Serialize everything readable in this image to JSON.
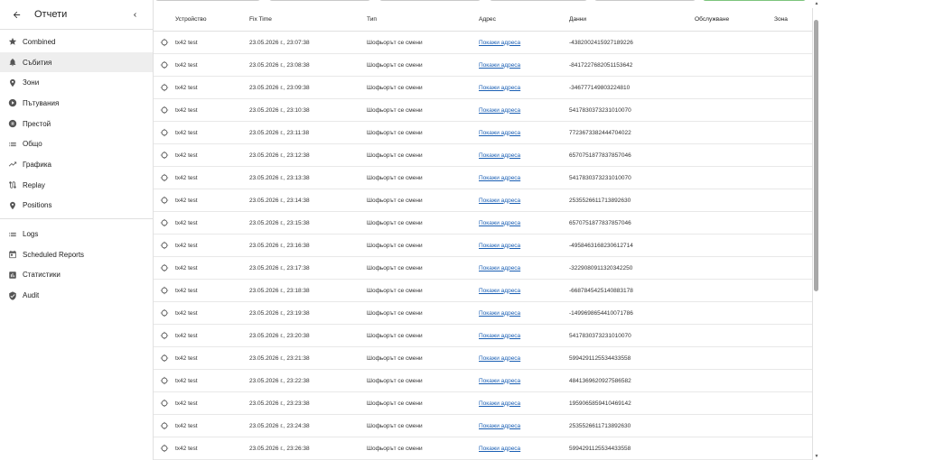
{
  "sidebar": {
    "title": "Отчети",
    "items_primary": [
      {
        "label": "Combined",
        "icon": "star-icon"
      },
      {
        "label": "Събития",
        "icon": "bell-icon",
        "active": true
      },
      {
        "label": "Зони",
        "icon": "place-icon"
      },
      {
        "label": "Пътувания",
        "icon": "play-circle-icon"
      },
      {
        "label": "Престой",
        "icon": "pause-circle-icon"
      },
      {
        "label": "Общо",
        "icon": "list-icon"
      },
      {
        "label": "Графика",
        "icon": "trending-up-icon"
      },
      {
        "label": "Replay",
        "icon": "route-icon"
      },
      {
        "label": "Positions",
        "icon": "place-icon"
      }
    ],
    "items_secondary": [
      {
        "label": "Logs",
        "icon": "list-icon"
      },
      {
        "label": "Scheduled Reports",
        "icon": "calendar-icon"
      },
      {
        "label": "Статистики",
        "icon": "chart-icon"
      },
      {
        "label": "Audit",
        "icon": "verified-icon"
      }
    ]
  },
  "table": {
    "headers": [
      "Устройство",
      "Fix Time",
      "Тип",
      "Адрес",
      "Данни",
      "Обслужване",
      "Зона"
    ],
    "rows": [
      {
        "device": "tx42 test",
        "time": "23.05.2026 г., 23:07:38",
        "type": "Шофьорът се смени",
        "address": "Покажи адреса",
        "data": "-4382002415927189226"
      },
      {
        "device": "tx42 test",
        "time": "23.05.2026 г., 23:08:38",
        "type": "Шофьорът се смени",
        "address": "Покажи адреса",
        "data": "-8417227682051153642"
      },
      {
        "device": "tx42 test",
        "time": "23.05.2026 г., 23:09:38",
        "type": "Шофьорът се смени",
        "address": "Покажи адреса",
        "data": "-346777149803224810"
      },
      {
        "device": "tx42 test",
        "time": "23.05.2026 г., 23:10:38",
        "type": "Шофьорът се смени",
        "address": "Покажи адреса",
        "data": "5417830373231010070"
      },
      {
        "device": "tx42 test",
        "time": "23.05.2026 г., 23:11:38",
        "type": "Шофьорът се смени",
        "address": "Покажи адреса",
        "data": "7723673382444704022"
      },
      {
        "device": "tx42 test",
        "time": "23.05.2026 г., 23:12:38",
        "type": "Шофьорът се смени",
        "address": "Покажи адреса",
        "data": "6570751877837857046"
      },
      {
        "device": "tx42 test",
        "time": "23.05.2026 г., 23:13:38",
        "type": "Шофьорът се смени",
        "address": "Покажи адреса",
        "data": "5417830373231010070"
      },
      {
        "device": "tx42 test",
        "time": "23.05.2026 г., 23:14:38",
        "type": "Шофьорът се смени",
        "address": "Покажи адреса",
        "data": "2535526611713892630"
      },
      {
        "device": "tx42 test",
        "time": "23.05.2026 г., 23:15:38",
        "type": "Шофьорът се смени",
        "address": "Покажи адреса",
        "data": "6570751877837857046"
      },
      {
        "device": "tx42 test",
        "time": "23.05.2026 г., 23:16:38",
        "type": "Шофьорът се смени",
        "address": "Покажи адреса",
        "data": "-4958463168230612714"
      },
      {
        "device": "tx42 test",
        "time": "23.05.2026 г., 23:17:38",
        "type": "Шофьорът се смени",
        "address": "Покажи адреса",
        "data": "-3229080911320342250"
      },
      {
        "device": "tx42 test",
        "time": "23.05.2026 г., 23:18:38",
        "type": "Шофьорът се смени",
        "address": "Покажи адреса",
        "data": "-6687845425140883178"
      },
      {
        "device": "tx42 test",
        "time": "23.05.2026 г., 23:19:38",
        "type": "Шофьорът се смени",
        "address": "Покажи адреса",
        "data": "-1499698654410071786"
      },
      {
        "device": "tx42 test",
        "time": "23.05.2026 г., 23:20:38",
        "type": "Шофьорът се смени",
        "address": "Покажи адреса",
        "data": "5417830373231010070"
      },
      {
        "device": "tx42 test",
        "time": "23.05.2026 г., 23:21:38",
        "type": "Шофьорът се смени",
        "address": "Покажи адреса",
        "data": "5994291125534433558"
      },
      {
        "device": "tx42 test",
        "time": "23.05.2026 г., 23:22:38",
        "type": "Шофьорът се смени",
        "address": "Покажи адреса",
        "data": "4841369620927586582"
      },
      {
        "device": "tx42 test",
        "time": "23.05.2026 г., 23:23:38",
        "type": "Шофьорът се смени",
        "address": "Покажи адреса",
        "data": "1959065859410469142"
      },
      {
        "device": "tx42 test",
        "time": "23.05.2026 г., 23:24:38",
        "type": "Шофьорът се смени",
        "address": "Покажи адреса",
        "data": "2535526611713892630"
      },
      {
        "device": "tx42 test",
        "time": "23.05.2026 г., 23:26:38",
        "type": "Шофьорът се смени",
        "address": "Покажи адреса",
        "data": "5994291125534433558"
      }
    ]
  },
  "colors": {
    "link": "#1a5fb4",
    "active_bg": "#eeeeee",
    "scroll_thumb": "#a8a8a8"
  }
}
